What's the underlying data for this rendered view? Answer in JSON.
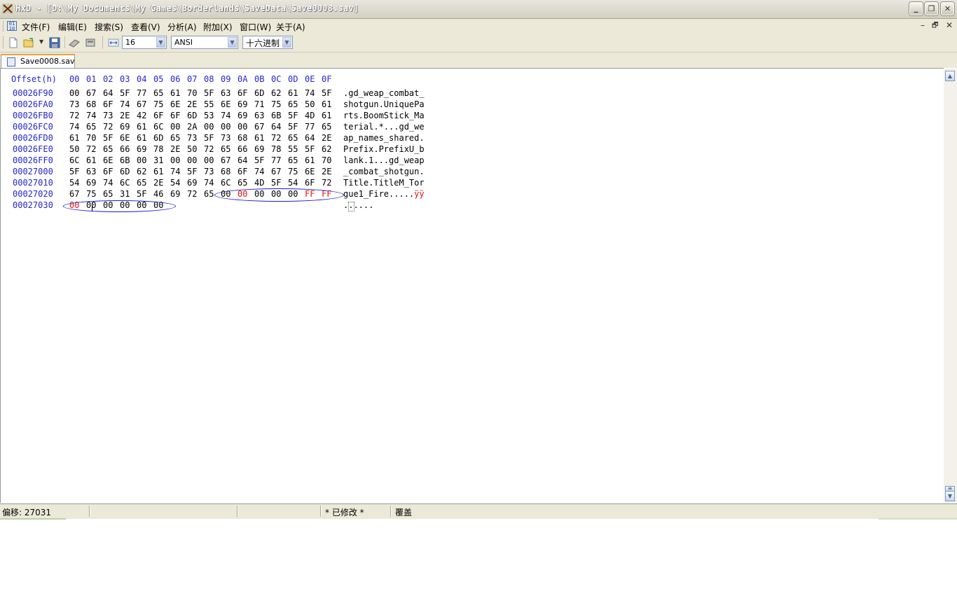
{
  "window": {
    "title": "HxD - [D:\\My Documents\\My Games\\Borderlands\\SaveData\\Save0008.sav]",
    "buttons": {
      "minimize": "_",
      "restore": "❐",
      "close": "✕"
    }
  },
  "menu": {
    "items": [
      "文件(F)",
      "编辑(E)",
      "搜索(S)",
      "查看(V)",
      "分析(A)",
      "附加(X)",
      "窗口(W)",
      "关于(A)"
    ],
    "mdi_controls": {
      "minimize": "–",
      "restore": "🗗",
      "close": "✕"
    }
  },
  "toolbar": {
    "bytes_per_row": "16",
    "charset": "ANSI",
    "offset_base": "十六进制"
  },
  "tab": {
    "label": "Save0008.sav"
  },
  "hex_view": {
    "header_offset_label": "Offset(h)",
    "columns": [
      "00",
      "01",
      "02",
      "03",
      "04",
      "05",
      "06",
      "07",
      "08",
      "09",
      "0A",
      "0B",
      "0C",
      "0D",
      "0E",
      "0F"
    ],
    "rows": [
      {
        "offset": "00026F90",
        "bytes": [
          "00",
          "67",
          "64",
          "5F",
          "77",
          "65",
          "61",
          "70",
          "5F",
          "63",
          "6F",
          "6D",
          "62",
          "61",
          "74",
          "5F"
        ],
        "ascii": ".gd_weap_combat_"
      },
      {
        "offset": "00026FA0",
        "bytes": [
          "73",
          "68",
          "6F",
          "74",
          "67",
          "75",
          "6E",
          "2E",
          "55",
          "6E",
          "69",
          "71",
          "75",
          "65",
          "50",
          "61"
        ],
        "ascii": "shotgun.UniquePa"
      },
      {
        "offset": "00026FB0",
        "bytes": [
          "72",
          "74",
          "73",
          "2E",
          "42",
          "6F",
          "6F",
          "6D",
          "53",
          "74",
          "69",
          "63",
          "6B",
          "5F",
          "4D",
          "61"
        ],
        "ascii": "rts.BoomStick_Ma"
      },
      {
        "offset": "00026FC0",
        "bytes": [
          "74",
          "65",
          "72",
          "69",
          "61",
          "6C",
          "00",
          "2A",
          "00",
          "00",
          "00",
          "67",
          "64",
          "5F",
          "77",
          "65"
        ],
        "ascii": "terial.*...gd_we"
      },
      {
        "offset": "00026FD0",
        "bytes": [
          "61",
          "70",
          "5F",
          "6E",
          "61",
          "6D",
          "65",
          "73",
          "5F",
          "73",
          "68",
          "61",
          "72",
          "65",
          "64",
          "2E"
        ],
        "ascii": "ap_names_shared."
      },
      {
        "offset": "00026FE0",
        "bytes": [
          "50",
          "72",
          "65",
          "66",
          "69",
          "78",
          "2E",
          "50",
          "72",
          "65",
          "66",
          "69",
          "78",
          "55",
          "5F",
          "62"
        ],
        "ascii": "Prefix.PrefixU_b"
      },
      {
        "offset": "00026FF0",
        "bytes": [
          "6C",
          "61",
          "6E",
          "6B",
          "00",
          "31",
          "00",
          "00",
          "00",
          "67",
          "64",
          "5F",
          "77",
          "65",
          "61",
          "70"
        ],
        "ascii": "lank.1...gd_weap"
      },
      {
        "offset": "00027000",
        "bytes": [
          "5F",
          "63",
          "6F",
          "6D",
          "62",
          "61",
          "74",
          "5F",
          "73",
          "68",
          "6F",
          "74",
          "67",
          "75",
          "6E",
          "2E"
        ],
        "ascii": "_combat_shotgun."
      },
      {
        "offset": "00027010",
        "bytes": [
          "54",
          "69",
          "74",
          "6C",
          "65",
          "2E",
          "54",
          "69",
          "74",
          "6C",
          "65",
          "4D",
          "5F",
          "54",
          "6F",
          "72"
        ],
        "ascii": "Title.TitleM_Tor"
      },
      {
        "offset": "00027020",
        "bytes": [
          "67",
          "75",
          "65",
          "31",
          "5F",
          "46",
          "69",
          "72",
          "65",
          "00",
          "00",
          "00",
          "00",
          "00",
          "FF",
          "FF"
        ],
        "ascii_plain": "gue1_Fire.....",
        "ascii_mod": "ÿÿ"
      },
      {
        "offset": "00027030",
        "bytes": [
          "00",
          "00",
          "00",
          "00",
          "00",
          "00"
        ],
        "ascii": "......"
      }
    ]
  },
  "status": {
    "offset": "偏移: 27031",
    "modified": "* 已修改 *",
    "mode": "覆盖"
  },
  "colors": {
    "offset_blue": "#2424d4",
    "modified_red": "#e01414",
    "annotation_blue": "#1a1ad0"
  }
}
